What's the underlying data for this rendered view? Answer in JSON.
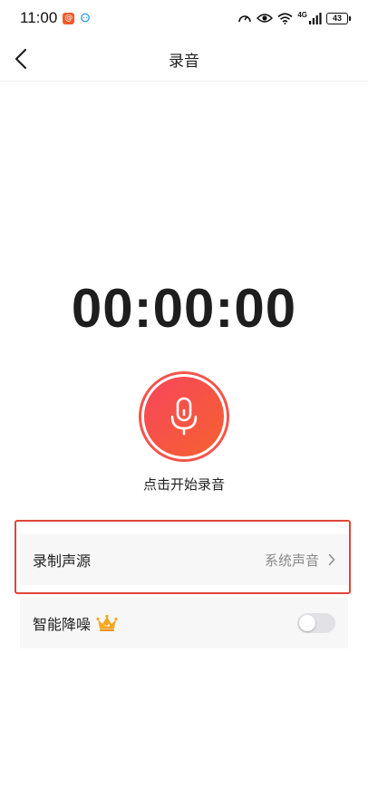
{
  "status_bar": {
    "time": "11:00",
    "notif_badge_glyph": "@",
    "network_label": "4G",
    "battery": "43"
  },
  "nav": {
    "title": "录音"
  },
  "recorder": {
    "timer": "00:00:00",
    "hint": "点击开始录音"
  },
  "settings": {
    "source_label": "录制声源",
    "source_value": "系统声音",
    "noise_label": "智能降噪",
    "noise_enabled": false
  },
  "colors": {
    "record_gradient_start": "#f7455c",
    "record_gradient_end": "#f6622f",
    "highlight_frame": "#e0443a",
    "vip_crown": "#f5a623"
  },
  "icons": {
    "back": "chevron-left-icon",
    "mic": "microphone-icon",
    "chevron": "chevron-right-icon",
    "vip": "vip-crown-icon"
  }
}
